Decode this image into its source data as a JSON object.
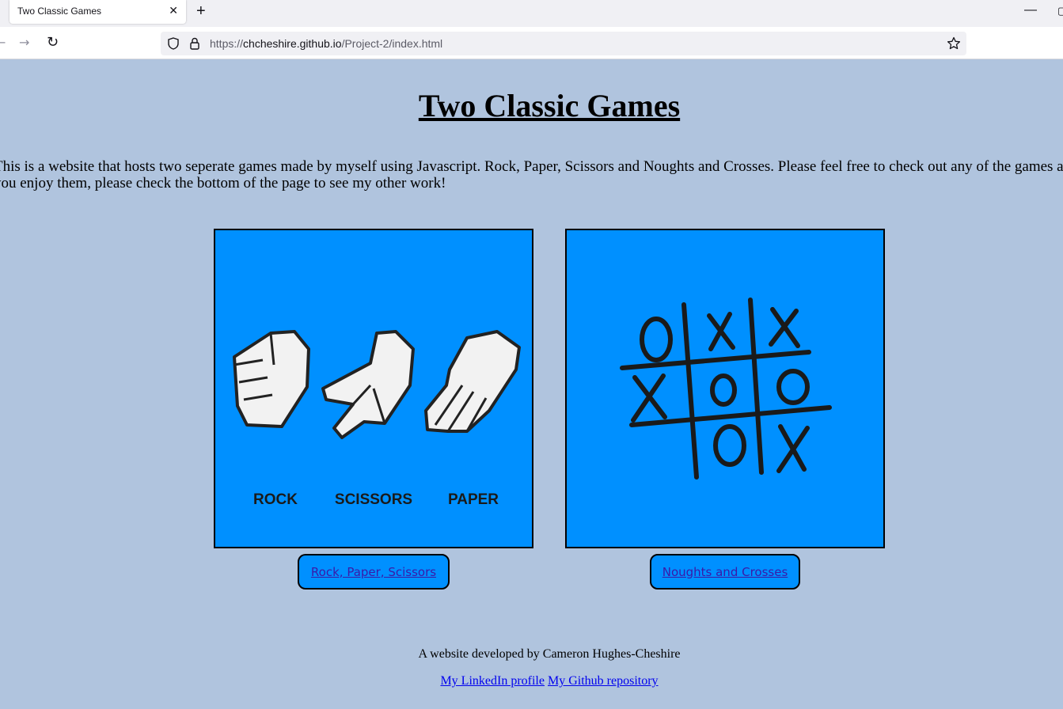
{
  "browser": {
    "tab_title": "Two Classic Games",
    "tab_close": "✕",
    "new_tab": "+",
    "url_prefix": "https://",
    "url_host": "chcheshire.github.io",
    "url_path": "/Project-2/index.html"
  },
  "page": {
    "title": "Two Classic Games",
    "intro": "This is a website that hosts two seperate games made by myself using Javascript. Rock, Paper, Scissors and Noughts and Crosses. Please feel free to check out any of the games and, if you enjoy them, please check the bottom of the page to see my other work!",
    "background_color": "#b0c4de",
    "accent_color": "#0090ff"
  },
  "games": [
    {
      "button_label": "Rock, Paper, Scissors",
      "image_labels": [
        "ROCK",
        "SCISSORS",
        "PAPER"
      ]
    },
    {
      "button_label": "Noughts and Crosses"
    }
  ],
  "footer": {
    "credit": "A website developed by Cameron Hughes-Cheshire",
    "linkedin_label": "My LinkedIn profile",
    "github_label": "My Github repository"
  }
}
